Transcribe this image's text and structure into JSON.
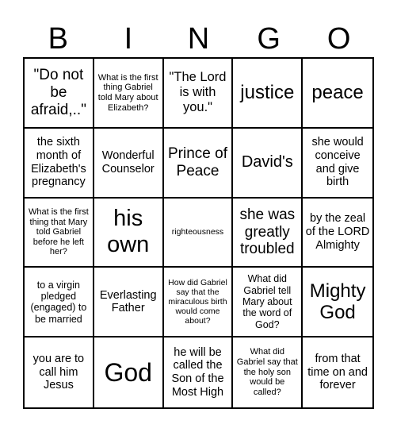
{
  "header": {
    "letters": [
      "B",
      "I",
      "N",
      "G",
      "O"
    ]
  },
  "board": {
    "rows": [
      [
        "\"Do not be afraid,..\"",
        "What is the first thing Gabriel told Mary about Elizabeth?",
        "\"The Lord is with you.\"",
        "justice",
        "peace"
      ],
      [
        "the sixth month of Elizabeth's pregnancy",
        "Wonderful Counselor",
        "Prince of Peace",
        "David's",
        "she would conceive and give birth"
      ],
      [
        "What is the first thing that Mary told Gabriel before he left her?",
        "his own",
        "righteousness",
        "she was greatly troubled",
        "by the zeal of the LORD Almighty"
      ],
      [
        "to a virgin pledged (engaged) to be married",
        "Everlasting Father",
        "How did Gabriel say that the miraculous birth would come about?",
        "What did Gabriel tell Mary about the word of God?",
        "Mighty God"
      ],
      [
        "you are to call him Jesus",
        "God",
        "he will be called the Son of the Most High",
        "What did Gabriel say that the holy son would be called?",
        "from that time on and forever"
      ]
    ]
  }
}
